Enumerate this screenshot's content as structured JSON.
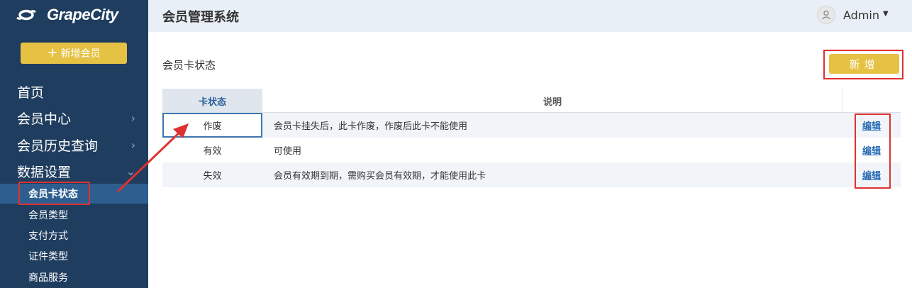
{
  "sidebar": {
    "logo_text": "GrapeCity",
    "add_member_label": "新增会员",
    "nav": [
      {
        "label": "首页",
        "chevron": ""
      },
      {
        "label": "会员中心",
        "chevron": "›"
      },
      {
        "label": "会员历史查询",
        "chevron": "›"
      },
      {
        "label": "数据设置",
        "chevron": "⌄"
      }
    ],
    "sub_items": [
      {
        "label": "会员卡状态",
        "active": true
      },
      {
        "label": "会员类型"
      },
      {
        "label": "支付方式"
      },
      {
        "label": "证件类型"
      },
      {
        "label": "商品服务"
      }
    ]
  },
  "header": {
    "title": "会员管理系统",
    "user": "Admin"
  },
  "content": {
    "section_title": "会员卡状态",
    "new_button": "新增",
    "table": {
      "headers": [
        "卡状态",
        "说明"
      ],
      "rows": [
        {
          "status": "作废",
          "desc": "会员卡挂失后，此卡作废，作废后此卡不能使用",
          "action": "编辑"
        },
        {
          "status": "有效",
          "desc": "可使用",
          "action": "编辑"
        },
        {
          "status": "失效",
          "desc": "会员有效期到期，需购买会员有效期，才能使用此卡",
          "action": "编辑"
        }
      ]
    }
  },
  "colors": {
    "sidebar_bg": "#1f3d5f",
    "accent_yellow": "#e6c244",
    "highlight_red": "#e03131",
    "link_blue": "#2a6bb5"
  }
}
